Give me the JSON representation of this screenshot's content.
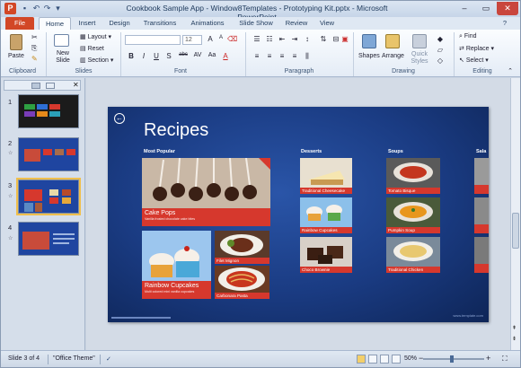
{
  "window": {
    "title": "Cookbook Sample App - Window8Templates - Prototyping Kit.pptx - Microsoft PowerPoint",
    "app_icon": "P"
  },
  "tabs": [
    "File",
    "Home",
    "Insert",
    "Design",
    "Transitions",
    "Animations",
    "Slide Show",
    "Review",
    "View"
  ],
  "ribbon": {
    "groups": [
      "Clipboard",
      "Slides",
      "Font",
      "Paragraph",
      "Drawing",
      "Editing"
    ],
    "paste": "Paste",
    "new_slide": "New Slide",
    "layout": "Layout",
    "reset": "Reset",
    "section": "Section",
    "font_size": "12",
    "shapes": "Shapes",
    "arrange": "Arrange",
    "quick_styles": "Quick Styles",
    "find": "Find",
    "replace": "Replace",
    "select": "Select",
    "bold": "B",
    "italic": "I",
    "underline": "U",
    "shadow": "S",
    "strike": "abc",
    "font_color": "A",
    "aa": "Aa"
  },
  "slide": {
    "title": "Recipes",
    "sections": {
      "popular": "Most Popular",
      "desserts": "Desserts",
      "soups": "Soups",
      "salads": "Sala"
    },
    "tiles": {
      "cake_pops": {
        "title": "Cake Pops",
        "sub": "Vanilla frosted chocolate cake bites"
      },
      "rainbow_big": {
        "title": "Rainbow Cupcakes",
        "sub": "Multi colored mini vanilla cupcakes"
      },
      "filet": "Filet Mignon",
      "carbonara": "Carbonara Pasta",
      "cheesecake": "Traditional Cheesecake",
      "rainbow_small": "Rainbow Cupcakes",
      "brownie": "Choco Brownie",
      "tomato": "Tomato Bisque",
      "pumpkin": "Pumpkin Soup",
      "chicken": "Traditional Chicken"
    },
    "watermark": "www.template.com"
  },
  "thumbnails": [
    {
      "num": "1"
    },
    {
      "num": "2",
      "star": "☆"
    },
    {
      "num": "3",
      "star": "☆"
    },
    {
      "num": "4",
      "star": "☆"
    }
  ],
  "status": {
    "slide": "Slide 3 of 4",
    "theme": "\"Office Theme\"",
    "zoom": "50%",
    "minus": "−",
    "plus": "+"
  },
  "colors": {
    "accent_red": "#d6382d",
    "slide_blue": "#1a3b82",
    "file_tab": "#d24726"
  }
}
